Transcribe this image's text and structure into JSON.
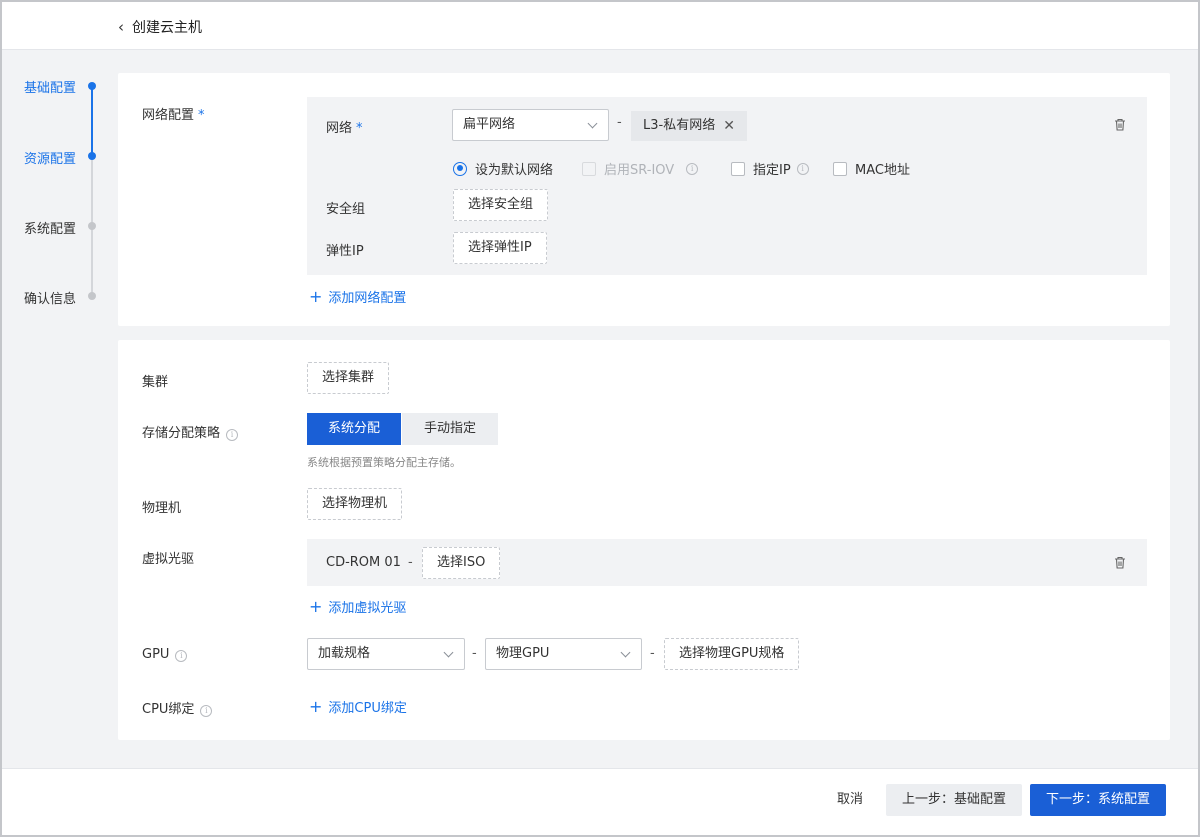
{
  "header": {
    "title": "创建云主机"
  },
  "steps": [
    {
      "label": "基础配置"
    },
    {
      "label": "资源配置"
    },
    {
      "label": "系统配置"
    },
    {
      "label": "确认信息"
    }
  ],
  "network": {
    "section_label": "网络配置",
    "required_mark": "*",
    "net_label": "网络",
    "net_type": "扁平网络",
    "separator": "-",
    "net_tag": "L3-私有网络",
    "default_net": "设为默认网络",
    "sriov": "启用SR-IOV",
    "fixed_ip": "指定IP",
    "mac": "MAC地址",
    "sg_label": "安全组",
    "sg_button": "选择安全组",
    "eip_label": "弹性IP",
    "eip_button": "选择弹性IP",
    "add_link": "添加网络配置"
  },
  "resources": {
    "cluster_label": "集群",
    "cluster_button": "选择集群",
    "storage_label": "存储分配策略",
    "storage_options": [
      "系统分配",
      "手动指定"
    ],
    "storage_hint": "系统根据预置策略分配主存储。",
    "host_label": "物理机",
    "host_button": "选择物理机",
    "cdrom_label": "虚拟光驱",
    "cdrom_name": "CD-ROM 01",
    "cdrom_sep": "-",
    "cdrom_button": "选择ISO",
    "cdrom_add": "添加虚拟光驱",
    "gpu_label": "GPU",
    "gpu_mode": "加载规格",
    "gpu_type": "物理GPU",
    "gpu_sep": "-",
    "gpu_button": "选择物理GPU规格",
    "cpu_label": "CPU绑定",
    "cpu_add": "添加CPU绑定"
  },
  "footer": {
    "cancel": "取消",
    "prev": "上一步：基础配置",
    "next": "下一步：系统配置"
  },
  "colors": {
    "accent": "#1a73e8",
    "primary_button": "#1a5fd6"
  }
}
